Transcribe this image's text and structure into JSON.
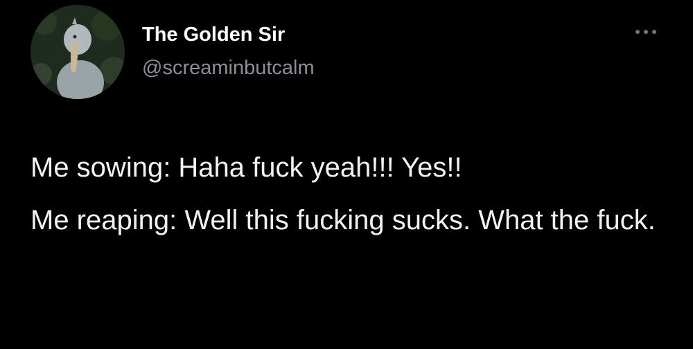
{
  "author": {
    "display_name": "The Golden Sir",
    "handle": "@screaminbutcalm",
    "avatar_icon": "shoebill-bird-avatar"
  },
  "menu": {
    "icon": "more-horizontal-icon"
  },
  "tweet": {
    "lines": [
      "Me sowing: Haha fuck yeah!!! Yes!!",
      "Me reaping: Well this fucking sucks. What the fuck."
    ]
  },
  "colors": {
    "background": "#000000",
    "name": "#ffffff",
    "handle": "#8b9096",
    "text": "#f2f2f2"
  }
}
